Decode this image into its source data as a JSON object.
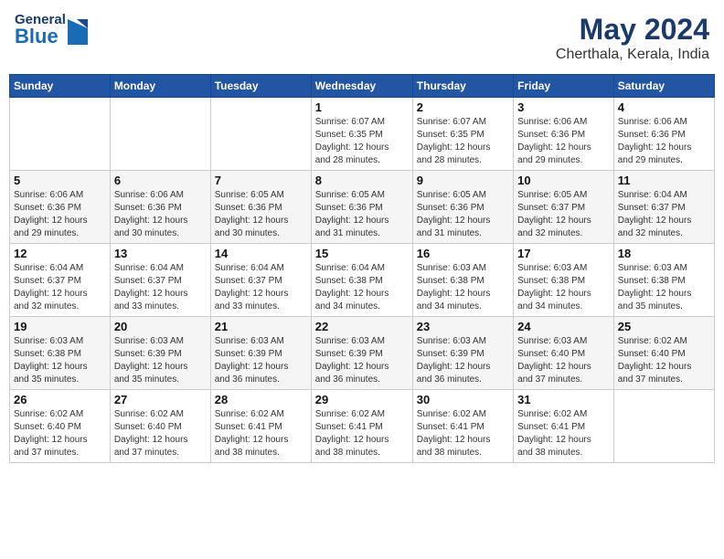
{
  "header": {
    "logo_general": "General",
    "logo_blue": "Blue",
    "title": "May 2024",
    "subtitle": "Cherthala, Kerala, India"
  },
  "calendar": {
    "days_header": [
      "Sunday",
      "Monday",
      "Tuesday",
      "Wednesday",
      "Thursday",
      "Friday",
      "Saturday"
    ],
    "weeks": [
      [
        {
          "day": "",
          "info": ""
        },
        {
          "day": "",
          "info": ""
        },
        {
          "day": "",
          "info": ""
        },
        {
          "day": "1",
          "info": "Sunrise: 6:07 AM\nSunset: 6:35 PM\nDaylight: 12 hours\nand 28 minutes."
        },
        {
          "day": "2",
          "info": "Sunrise: 6:07 AM\nSunset: 6:35 PM\nDaylight: 12 hours\nand 28 minutes."
        },
        {
          "day": "3",
          "info": "Sunrise: 6:06 AM\nSunset: 6:36 PM\nDaylight: 12 hours\nand 29 minutes."
        },
        {
          "day": "4",
          "info": "Sunrise: 6:06 AM\nSunset: 6:36 PM\nDaylight: 12 hours\nand 29 minutes."
        }
      ],
      [
        {
          "day": "5",
          "info": "Sunrise: 6:06 AM\nSunset: 6:36 PM\nDaylight: 12 hours\nand 29 minutes."
        },
        {
          "day": "6",
          "info": "Sunrise: 6:06 AM\nSunset: 6:36 PM\nDaylight: 12 hours\nand 30 minutes."
        },
        {
          "day": "7",
          "info": "Sunrise: 6:05 AM\nSunset: 6:36 PM\nDaylight: 12 hours\nand 30 minutes."
        },
        {
          "day": "8",
          "info": "Sunrise: 6:05 AM\nSunset: 6:36 PM\nDaylight: 12 hours\nand 31 minutes."
        },
        {
          "day": "9",
          "info": "Sunrise: 6:05 AM\nSunset: 6:36 PM\nDaylight: 12 hours\nand 31 minutes."
        },
        {
          "day": "10",
          "info": "Sunrise: 6:05 AM\nSunset: 6:37 PM\nDaylight: 12 hours\nand 32 minutes."
        },
        {
          "day": "11",
          "info": "Sunrise: 6:04 AM\nSunset: 6:37 PM\nDaylight: 12 hours\nand 32 minutes."
        }
      ],
      [
        {
          "day": "12",
          "info": "Sunrise: 6:04 AM\nSunset: 6:37 PM\nDaylight: 12 hours\nand 32 minutes."
        },
        {
          "day": "13",
          "info": "Sunrise: 6:04 AM\nSunset: 6:37 PM\nDaylight: 12 hours\nand 33 minutes."
        },
        {
          "day": "14",
          "info": "Sunrise: 6:04 AM\nSunset: 6:37 PM\nDaylight: 12 hours\nand 33 minutes."
        },
        {
          "day": "15",
          "info": "Sunrise: 6:04 AM\nSunset: 6:38 PM\nDaylight: 12 hours\nand 34 minutes."
        },
        {
          "day": "16",
          "info": "Sunrise: 6:03 AM\nSunset: 6:38 PM\nDaylight: 12 hours\nand 34 minutes."
        },
        {
          "day": "17",
          "info": "Sunrise: 6:03 AM\nSunset: 6:38 PM\nDaylight: 12 hours\nand 34 minutes."
        },
        {
          "day": "18",
          "info": "Sunrise: 6:03 AM\nSunset: 6:38 PM\nDaylight: 12 hours\nand 35 minutes."
        }
      ],
      [
        {
          "day": "19",
          "info": "Sunrise: 6:03 AM\nSunset: 6:38 PM\nDaylight: 12 hours\nand 35 minutes."
        },
        {
          "day": "20",
          "info": "Sunrise: 6:03 AM\nSunset: 6:39 PM\nDaylight: 12 hours\nand 35 minutes."
        },
        {
          "day": "21",
          "info": "Sunrise: 6:03 AM\nSunset: 6:39 PM\nDaylight: 12 hours\nand 36 minutes."
        },
        {
          "day": "22",
          "info": "Sunrise: 6:03 AM\nSunset: 6:39 PM\nDaylight: 12 hours\nand 36 minutes."
        },
        {
          "day": "23",
          "info": "Sunrise: 6:03 AM\nSunset: 6:39 PM\nDaylight: 12 hours\nand 36 minutes."
        },
        {
          "day": "24",
          "info": "Sunrise: 6:03 AM\nSunset: 6:40 PM\nDaylight: 12 hours\nand 37 minutes."
        },
        {
          "day": "25",
          "info": "Sunrise: 6:02 AM\nSunset: 6:40 PM\nDaylight: 12 hours\nand 37 minutes."
        }
      ],
      [
        {
          "day": "26",
          "info": "Sunrise: 6:02 AM\nSunset: 6:40 PM\nDaylight: 12 hours\nand 37 minutes."
        },
        {
          "day": "27",
          "info": "Sunrise: 6:02 AM\nSunset: 6:40 PM\nDaylight: 12 hours\nand 37 minutes."
        },
        {
          "day": "28",
          "info": "Sunrise: 6:02 AM\nSunset: 6:41 PM\nDaylight: 12 hours\nand 38 minutes."
        },
        {
          "day": "29",
          "info": "Sunrise: 6:02 AM\nSunset: 6:41 PM\nDaylight: 12 hours\nand 38 minutes."
        },
        {
          "day": "30",
          "info": "Sunrise: 6:02 AM\nSunset: 6:41 PM\nDaylight: 12 hours\nand 38 minutes."
        },
        {
          "day": "31",
          "info": "Sunrise: 6:02 AM\nSunset: 6:41 PM\nDaylight: 12 hours\nand 38 minutes."
        },
        {
          "day": "",
          "info": ""
        }
      ]
    ]
  }
}
